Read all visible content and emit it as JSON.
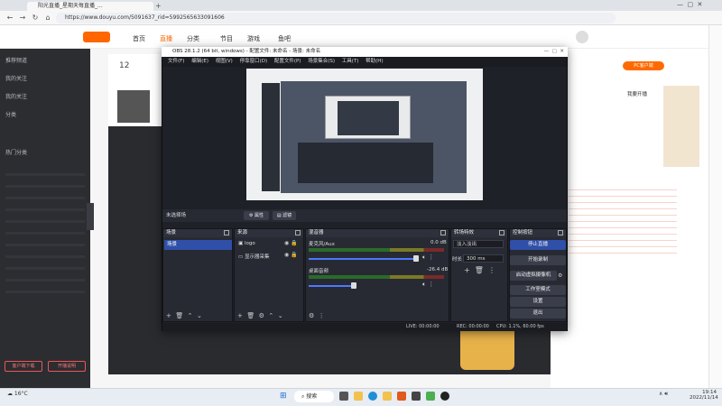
{
  "browser": {
    "tabs": [
      {
        "label": "阳光直播_星期天每直播_..."
      },
      {
        "label": ""
      }
    ],
    "url": "https://www.douyu.com/5091637_rid=5992565633091606"
  },
  "site": {
    "nav": [
      "首页",
      "直播",
      "分类",
      "节目",
      "游戏",
      "鱼吧"
    ],
    "left_menu": [
      "推荐频道",
      "我的关注",
      "我的关注",
      "分类",
      "热门分类"
    ],
    "left_buttons": [
      "客户端下载",
      "开播说明"
    ],
    "right_texts": [
      "PC客户端",
      "我要开播"
    ],
    "room_count": "12"
  },
  "obs": {
    "title": "OBS 28.1.2 (64 bit, windows) - 配置文件: 未命名 - 场景: 未命名",
    "menu": [
      "文件(F)",
      "编辑(E)",
      "视图(V)",
      "停靠窗口(D)",
      "配置文件(P)",
      "场景集合(S)",
      "工具(T)",
      "帮助(H)"
    ],
    "scene_bar": {
      "current": "未选择场",
      "props": "属性",
      "filters": "滤镜"
    },
    "docks": {
      "scenes": {
        "title": "场景",
        "items": [
          "场景"
        ]
      },
      "sources": {
        "title": "来源",
        "items": [
          "logo",
          "显示器采集"
        ]
      },
      "mixer": {
        "title": "混音器",
        "channels": [
          {
            "name": "麦克风/Aux",
            "db": "0.0 dB"
          },
          {
            "name": "桌面音频",
            "db": "-26.4 dB"
          }
        ]
      },
      "transitions": {
        "title": "转场特效",
        "type": "淡入淡出",
        "duration_label": "时长",
        "duration": "300 ms"
      },
      "controls": {
        "title": "控制按钮",
        "buttons": [
          "停止直播",
          "开始录制",
          "启动虚拟摄像机",
          "工作室模式",
          "设置",
          "退出"
        ]
      }
    },
    "status": {
      "live": "LIVE: 00:00:00",
      "rec": "REC: 00:00:00",
      "cpu": "CPU: 1.1%, 60.00 fps"
    }
  },
  "taskbar": {
    "search": "搜索",
    "weather": "16°C",
    "time": "19:14",
    "date": "2022/11/14"
  }
}
